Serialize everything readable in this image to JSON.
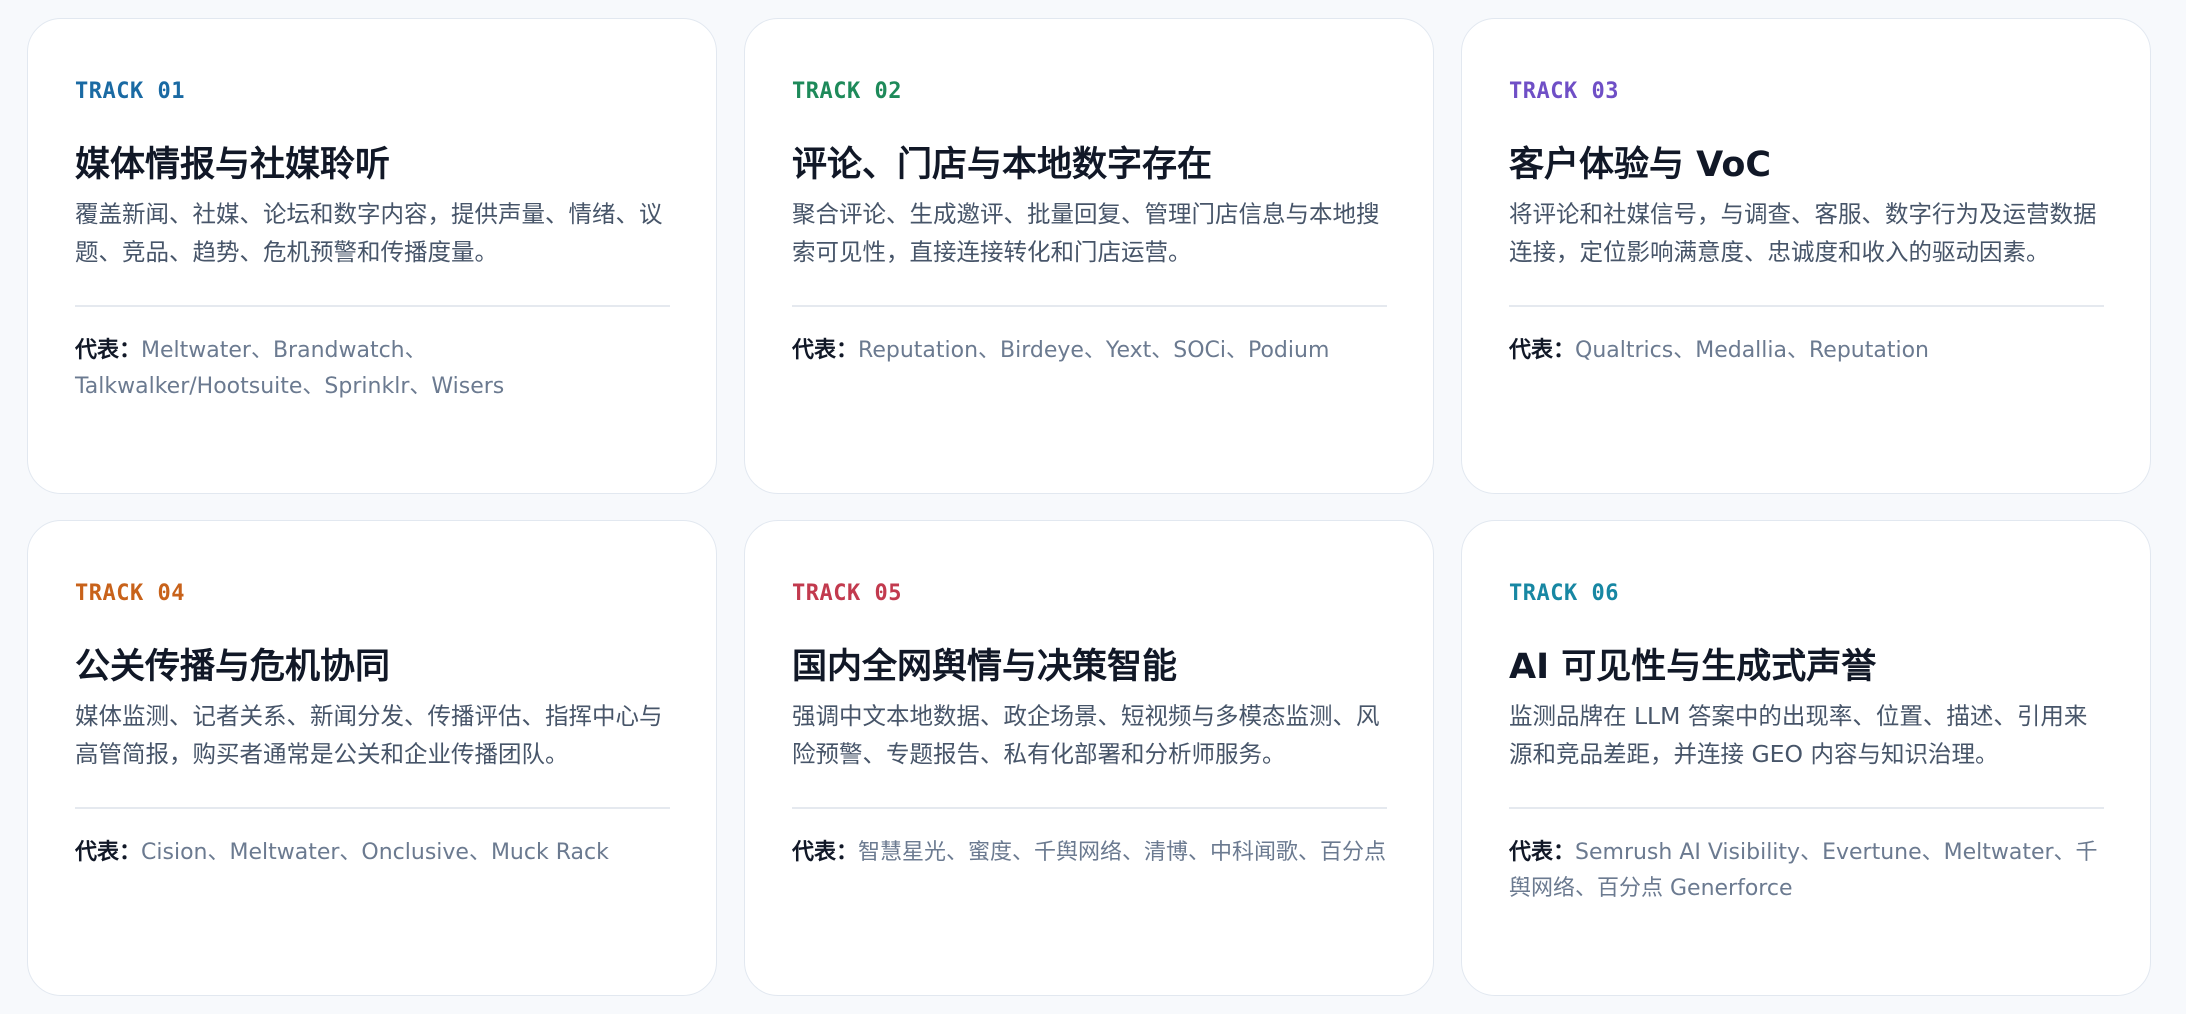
{
  "rep_prefix": "代表：",
  "colors": {
    "track_01": "#1a6aa3",
    "track_02": "#1e8a5a",
    "track_03": "#6f4fc6",
    "track_04": "#c8621a",
    "track_05": "#c23a4e",
    "track_06": "#1787a3"
  },
  "cards": [
    {
      "track": "TRACK 01",
      "title": "媒体情报与社媒聆听",
      "desc": "覆盖新闻、社媒、论坛和数字内容，提供声量、情绪、议题、竞品、趋势、危机预警和传播度量。",
      "reps": "Meltwater、Brandwatch、Talkwalker/Hootsuite、Sprinklr、Wisers"
    },
    {
      "track": "TRACK 02",
      "title": "评论、门店与本地数字存在",
      "desc": "聚合评论、生成邀评、批量回复、管理门店信息与本地搜索可见性，直接连接转化和门店运营。",
      "reps": "Reputation、Birdeye、Yext、SOCi、Podium"
    },
    {
      "track": "TRACK 03",
      "title": "客户体验与 VoC",
      "desc": "将评论和社媒信号，与调查、客服、数字行为及运营数据连接，定位影响满意度、忠诚度和收入的驱动因素。",
      "reps": "Qualtrics、Medallia、Reputation"
    },
    {
      "track": "TRACK 04",
      "title": "公关传播与危机协同",
      "desc": "媒体监测、记者关系、新闻分发、传播评估、指挥中心与高管简报，购买者通常是公关和企业传播团队。",
      "reps": "Cision、Meltwater、Onclusive、Muck Rack"
    },
    {
      "track": "TRACK 05",
      "title": "国内全网舆情与决策智能",
      "desc": "强调中文本地数据、政企场景、短视频与多模态监测、风险预警、专题报告、私有化部署和分析师服务。",
      "reps": "智慧星光、蜜度、千舆网络、清博、中科闻歌、百分点"
    },
    {
      "track": "TRACK 06",
      "title": "AI 可见性与生成式声誉",
      "desc": "监测品牌在 LLM 答案中的出现率、位置、描述、引用来源和竞品差距，并连接 GEO 内容与知识治理。",
      "reps": "Semrush AI Visibility、Evertune、Meltwater、千舆网络、百分点 Generforce"
    }
  ]
}
